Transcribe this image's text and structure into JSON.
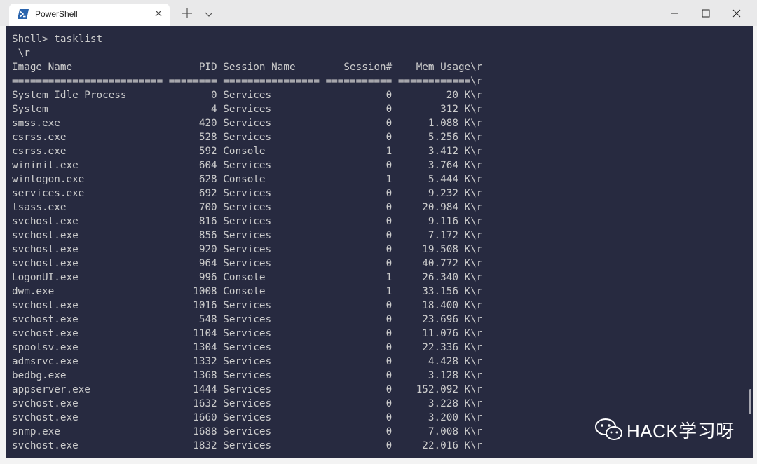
{
  "window": {
    "tab_title": "PowerShell",
    "icon_color": "#2a64ad"
  },
  "terminal": {
    "background": "#272a40",
    "foreground": "#cccccc",
    "prompt_line": "Shell> tasklist",
    "lines": [
      " \\r",
      "Image Name                     PID Session Name        Session#    Mem Usage\\r",
      "========================= ======== ================ =========== ============\\r",
      "System Idle Process              0 Services                   0         20 K\\r",
      "System                           4 Services                   0        312 K\\r",
      "smss.exe                       420 Services                   0      1.088 K\\r",
      "csrss.exe                      528 Services                   0      5.256 K\\r",
      "csrss.exe                      592 Console                    1      3.412 K\\r",
      "wininit.exe                    604 Services                   0      3.764 K\\r",
      "winlogon.exe                   628 Console                    1      5.444 K\\r",
      "services.exe                   692 Services                   0      9.232 K\\r",
      "lsass.exe                      700 Services                   0     20.984 K\\r",
      "svchost.exe                    816 Services                   0      9.116 K\\r",
      "svchost.exe                    856 Services                   0      7.172 K\\r",
      "svchost.exe                    920 Services                   0     19.508 K\\r",
      "svchost.exe                    964 Services                   0     40.772 K\\r",
      "LogonUI.exe                    996 Console                    1     26.340 K\\r",
      "dwm.exe                       1008 Console                    1     33.156 K\\r",
      "svchost.exe                   1016 Services                   0     18.400 K\\r",
      "svchost.exe                    548 Services                   0     23.696 K\\r",
      "svchost.exe                   1104 Services                   0     11.076 K\\r",
      "spoolsv.exe                   1304 Services                   0     22.336 K\\r",
      "admsrvc.exe                   1332 Services                   0      4.428 K\\r",
      "bedbg.exe                     1368 Services                   0      3.128 K\\r",
      "appserver.exe                 1444 Services                   0    152.092 K\\r",
      "svchost.exe                   1632 Services                   0      3.228 K\\r",
      "svchost.exe                   1660 Services                   0      3.200 K\\r",
      "snmp.exe                      1688 Services                   0      7.008 K\\r",
      "svchost.exe                   1832 Services                   0     22.016 K\\r"
    ]
  },
  "watermark": {
    "text": "HACK学习呀"
  }
}
